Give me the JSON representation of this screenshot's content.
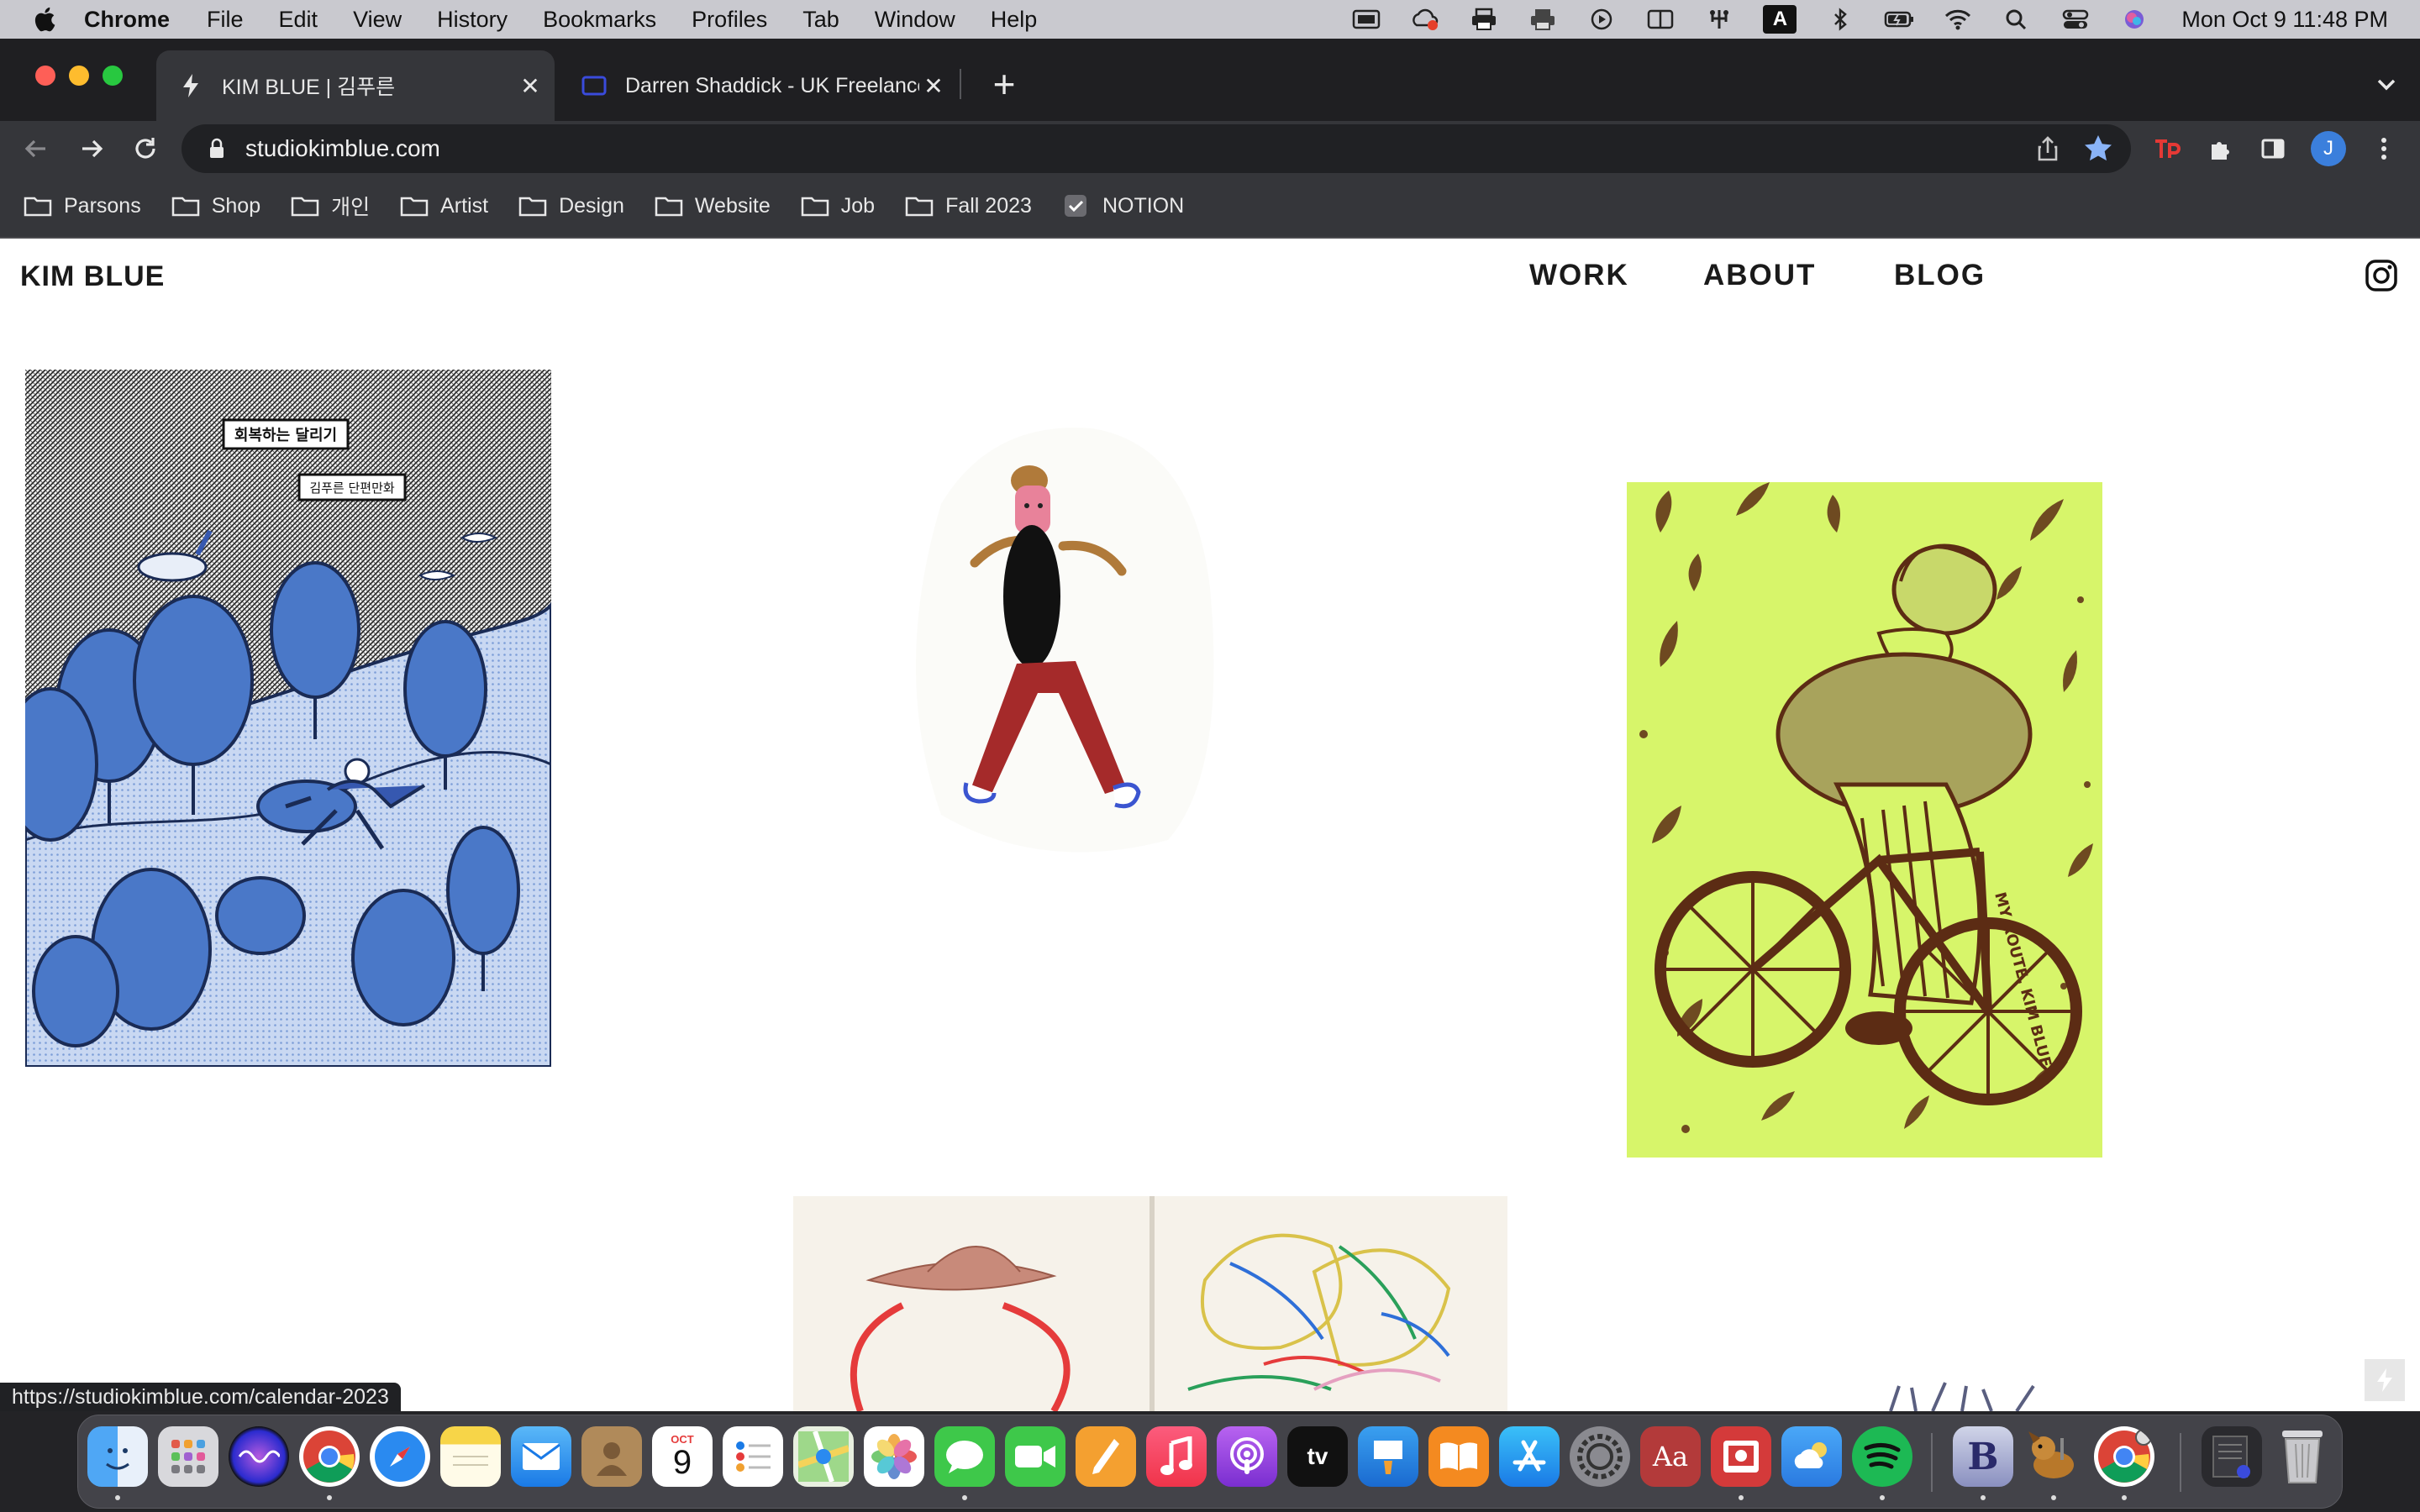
{
  "menubar": {
    "app_name": "Chrome",
    "menus": [
      "File",
      "Edit",
      "View",
      "History",
      "Bookmarks",
      "Profiles",
      "Tab",
      "Window",
      "Help"
    ],
    "status_a_label": "A",
    "clock": "Mon Oct 9  11:48 PM"
  },
  "browser": {
    "tabs": [
      {
        "title": "KIM BLUE | 김푸른"
      },
      {
        "title": "Darren Shaddick - UK Freelance"
      }
    ],
    "new_tab_label": "+",
    "url": "studiokimblue.com",
    "profile_initial": "J",
    "bookmarks": [
      {
        "label": "Parsons",
        "icon": "folder-icon"
      },
      {
        "label": "Shop",
        "icon": "folder-icon"
      },
      {
        "label": "개인",
        "icon": "folder-icon"
      },
      {
        "label": "Artist",
        "icon": "folder-icon"
      },
      {
        "label": "Design",
        "icon": "folder-icon"
      },
      {
        "label": "Website",
        "icon": "folder-icon"
      },
      {
        "label": "Job",
        "icon": "folder-icon"
      },
      {
        "label": "Fall 2023",
        "icon": "folder-icon"
      },
      {
        "label": "NOTION",
        "icon": "notion-icon"
      }
    ]
  },
  "site": {
    "title": "KIM BLUE",
    "nav": [
      "WORK",
      "ABOUT",
      "BLOG"
    ],
    "comic_title_1": "회복하는 달리기",
    "comic_title_2": "김푸른 단편만화",
    "bike_caption": "MY ROUTE. KIM BLUE",
    "status_url": "https://studiokimblue.com/calendar-2023"
  },
  "dock": {
    "calendar_month": "OCT",
    "calendar_day": "9",
    "appletv_label": "tv",
    "dictionary_label": "Aa",
    "bbedit_label": "B"
  },
  "colors": {
    "comic_blue": "#4a78c8",
    "bike_bg": "#d7f56a",
    "bike_ink": "#5c2c14",
    "pants_red": "#a52a2a",
    "hat_brown": "#b07a3a"
  }
}
